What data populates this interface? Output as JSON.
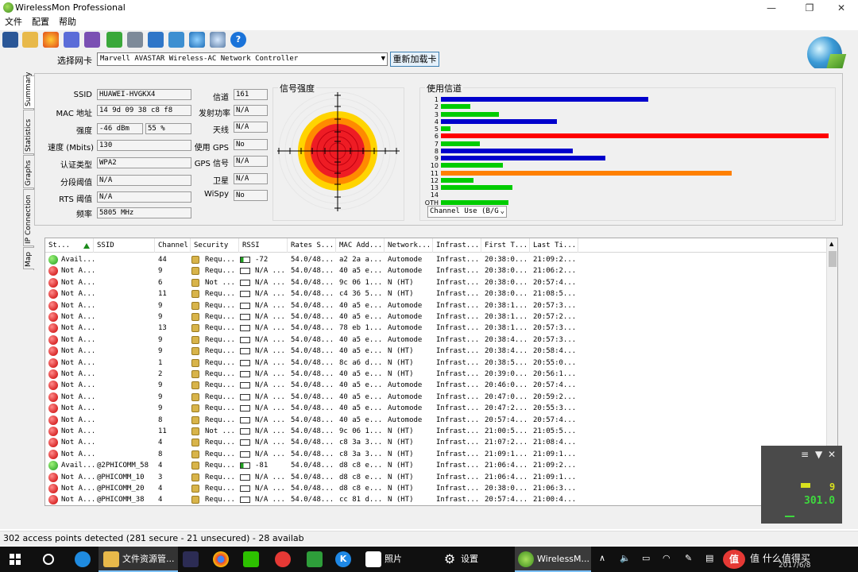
{
  "window": {
    "title": "WirelessMon Professional",
    "min": "—",
    "max": "❐",
    "close": "✕"
  },
  "menu": [
    "文件",
    "配置",
    "帮助"
  ],
  "nic": {
    "label": "选择网卡",
    "value": "Marvell AVASTAR Wireless-AC Network Controller",
    "reload": "重新加载卡"
  },
  "tabs": [
    "Summary",
    "Statistics",
    "Graphs",
    "IP Connection",
    "Map"
  ],
  "summary": {
    "ssid": {
      "label": "SSID",
      "value": "HUAWEI-HVGKX4"
    },
    "mac": {
      "label": "MAC 地址",
      "value": "14 9d 09 38 c8 f8"
    },
    "strength": {
      "label": "强度",
      "dbm": "-46 dBm",
      "pct": "55 %"
    },
    "speed": {
      "label": "速度 (Mbits)",
      "value": "130"
    },
    "auth": {
      "label": "认证类型",
      "value": "WPA2"
    },
    "frag": {
      "label": "分段阈值",
      "value": "N/A"
    },
    "rts": {
      "label": "RTS 阈值",
      "value": "N/A"
    },
    "freq": {
      "label": "频率",
      "value": "5805 MHz"
    },
    "channel": {
      "label": "信道",
      "value": "161"
    },
    "txpower": {
      "label": "发射功率",
      "value": "N/A"
    },
    "antenna": {
      "label": "天线",
      "value": "N/A"
    },
    "gps_use": {
      "label": "使用 GPS",
      "value": "No"
    },
    "gps_sig": {
      "label": "GPS 信号",
      "value": "N/A"
    },
    "sat": {
      "label": "卫星",
      "value": "N/A"
    },
    "wispy": {
      "label": "WiSpy",
      "value": "No"
    }
  },
  "signal_title": "信号强度",
  "channel_title": "使用信道",
  "channel_select": "Channel Use (B/G",
  "channel_max": 20,
  "channels": [
    {
      "label": "1",
      "value": 10.7,
      "color": "#0000cc"
    },
    {
      "label": "2",
      "value": 1.5,
      "color": "#00cc00"
    },
    {
      "label": "3",
      "value": 3.0,
      "color": "#00cc00"
    },
    {
      "label": "4",
      "value": 6.0,
      "color": "#0000cc"
    },
    {
      "label": "5",
      "value": 0.5,
      "color": "#00cc00"
    },
    {
      "label": "6",
      "value": 20.0,
      "color": "#ff0000"
    },
    {
      "label": "7",
      "value": 2.0,
      "color": "#00cc00"
    },
    {
      "label": "8",
      "value": 6.8,
      "color": "#0000cc"
    },
    {
      "label": "9",
      "value": 8.5,
      "color": "#0000cc"
    },
    {
      "label": "10",
      "value": 3.2,
      "color": "#00cc00"
    },
    {
      "label": "11",
      "value": 15.0,
      "color": "#ff8000"
    },
    {
      "label": "12",
      "value": 1.7,
      "color": "#00cc00"
    },
    {
      "label": "13",
      "value": 3.7,
      "color": "#00cc00"
    },
    {
      "label": "14",
      "value": 0,
      "color": "#00cc00"
    },
    {
      "label": "OTH",
      "value": 3.5,
      "color": "#00cc00"
    }
  ],
  "columns": [
    "St...",
    "SSID",
    "Channel",
    "Security",
    "RSSI",
    "Rates S...",
    "MAC Add...",
    "Network...",
    "Infrast...",
    "First T...",
    "Last Ti..."
  ],
  "rows": [
    {
      "status": "Avail...",
      "ok": true,
      "ssid": "",
      "ch": "44",
      "sec": "Requ...",
      "rssi": "-72",
      "rates": "54.0/48...",
      "mac": "a2 2a a...",
      "net": "Automode",
      "infra": "Infrast...",
      "first": "20:38:0...",
      "last": "21:09:2..."
    },
    {
      "status": "Not A...",
      "ok": false,
      "ssid": "",
      "ch": "9",
      "sec": "Requ...",
      "rssi": "N/A ...",
      "rates": "54.0/48...",
      "mac": "40 a5 e...",
      "net": "Automode",
      "infra": "Infrast...",
      "first": "20:38:0...",
      "last": "21:06:2..."
    },
    {
      "status": "Not A...",
      "ok": false,
      "ssid": "",
      "ch": "6",
      "sec": "Not ...",
      "rssi": "N/A ...",
      "rates": "54.0/48...",
      "mac": "9c 06 1...",
      "net": "N (HT)",
      "infra": "Infrast...",
      "first": "20:38:0...",
      "last": "20:57:4..."
    },
    {
      "status": "Not A...",
      "ok": false,
      "ssid": "",
      "ch": "11",
      "sec": "Requ...",
      "rssi": "N/A ...",
      "rates": "54.0/48...",
      "mac": "c4 36 5...",
      "net": "N (HT)",
      "infra": "Infrast...",
      "first": "20:38:0...",
      "last": "21:08:5..."
    },
    {
      "status": "Not A...",
      "ok": false,
      "ssid": "",
      "ch": "9",
      "sec": "Requ...",
      "rssi": "N/A ...",
      "rates": "54.0/48...",
      "mac": "40 a5 e...",
      "net": "Automode",
      "infra": "Infrast...",
      "first": "20:38:1...",
      "last": "20:57:3..."
    },
    {
      "status": "Not A...",
      "ok": false,
      "ssid": "",
      "ch": "9",
      "sec": "Requ...",
      "rssi": "N/A ...",
      "rates": "54.0/48...",
      "mac": "40 a5 e...",
      "net": "Automode",
      "infra": "Infrast...",
      "first": "20:38:1...",
      "last": "20:57:2..."
    },
    {
      "status": "Not A...",
      "ok": false,
      "ssid": "",
      "ch": "13",
      "sec": "Requ...",
      "rssi": "N/A ...",
      "rates": "54.0/48...",
      "mac": "78 eb 1...",
      "net": "Automode",
      "infra": "Infrast...",
      "first": "20:38:1...",
      "last": "20:57:3..."
    },
    {
      "status": "Not A...",
      "ok": false,
      "ssid": "",
      "ch": "9",
      "sec": "Requ...",
      "rssi": "N/A ...",
      "rates": "54.0/48...",
      "mac": "40 a5 e...",
      "net": "Automode",
      "infra": "Infrast...",
      "first": "20:38:4...",
      "last": "20:57:3..."
    },
    {
      "status": "Not A...",
      "ok": false,
      "ssid": "",
      "ch": "9",
      "sec": "Requ...",
      "rssi": "N/A ...",
      "rates": "54.0/48...",
      "mac": "40 a5 e...",
      "net": "N (HT)",
      "infra": "Infrast...",
      "first": "20:38:4...",
      "last": "20:58:4..."
    },
    {
      "status": "Not A...",
      "ok": false,
      "ssid": "",
      "ch": "1",
      "sec": "Requ...",
      "rssi": "N/A ...",
      "rates": "54.0/48...",
      "mac": "8c a6 d...",
      "net": "N (HT)",
      "infra": "Infrast...",
      "first": "20:38:5...",
      "last": "20:55:0..."
    },
    {
      "status": "Not A...",
      "ok": false,
      "ssid": "",
      "ch": "2",
      "sec": "Requ...",
      "rssi": "N/A ...",
      "rates": "54.0/48...",
      "mac": "40 a5 e...",
      "net": "N (HT)",
      "infra": "Infrast...",
      "first": "20:39:0...",
      "last": "20:56:1..."
    },
    {
      "status": "Not A...",
      "ok": false,
      "ssid": "",
      "ch": "9",
      "sec": "Requ...",
      "rssi": "N/A ...",
      "rates": "54.0/48...",
      "mac": "40 a5 e...",
      "net": "Automode",
      "infra": "Infrast...",
      "first": "20:46:0...",
      "last": "20:57:4..."
    },
    {
      "status": "Not A...",
      "ok": false,
      "ssid": "",
      "ch": "9",
      "sec": "Requ...",
      "rssi": "N/A ...",
      "rates": "54.0/48...",
      "mac": "40 a5 e...",
      "net": "Automode",
      "infra": "Infrast...",
      "first": "20:47:0...",
      "last": "20:59:2..."
    },
    {
      "status": "Not A...",
      "ok": false,
      "ssid": "",
      "ch": "9",
      "sec": "Requ...",
      "rssi": "N/A ...",
      "rates": "54.0/48...",
      "mac": "40 a5 e...",
      "net": "Automode",
      "infra": "Infrast...",
      "first": "20:47:2...",
      "last": "20:55:3..."
    },
    {
      "status": "Not A...",
      "ok": false,
      "ssid": "",
      "ch": "8",
      "sec": "Requ...",
      "rssi": "N/A ...",
      "rates": "54.0/48...",
      "mac": "40 a5 e...",
      "net": "Automode",
      "infra": "Infrast...",
      "first": "20:57:4...",
      "last": "20:57:4..."
    },
    {
      "status": "Not A...",
      "ok": false,
      "ssid": "",
      "ch": "11",
      "sec": "Not ...",
      "rssi": "N/A ...",
      "rates": "54.0/48...",
      "mac": "9c 06 1...",
      "net": "N (HT)",
      "infra": "Infrast...",
      "first": "21:00:5...",
      "last": "21:05:5..."
    },
    {
      "status": "Not A...",
      "ok": false,
      "ssid": "",
      "ch": "4",
      "sec": "Requ...",
      "rssi": "N/A ...",
      "rates": "54.0/48...",
      "mac": "c8 3a 3...",
      "net": "N (HT)",
      "infra": "Infrast...",
      "first": "21:07:2...",
      "last": "21:08:4..."
    },
    {
      "status": "Not A...",
      "ok": false,
      "ssid": "",
      "ch": "8",
      "sec": "Requ...",
      "rssi": "N/A ...",
      "rates": "54.0/48...",
      "mac": "c8 3a 3...",
      "net": "N (HT)",
      "infra": "Infrast...",
      "first": "21:09:1...",
      "last": "21:09:1..."
    },
    {
      "status": "Avail...",
      "ok": true,
      "ssid": "@2PHICOMM_58",
      "ch": "4",
      "sec": "Requ...",
      "rssi": "-81",
      "rates": "54.0/48...",
      "mac": "d8 c8 e...",
      "net": "N (HT)",
      "infra": "Infrast...",
      "first": "21:06:4...",
      "last": "21:09:2..."
    },
    {
      "status": "Not A...",
      "ok": false,
      "ssid": "@PHICOMM_10",
      "ch": "3",
      "sec": "Requ...",
      "rssi": "N/A ...",
      "rates": "54.0/48...",
      "mac": "d8 c8 e...",
      "net": "N (HT)",
      "infra": "Infrast...",
      "first": "21:06:4...",
      "last": "21:09:1..."
    },
    {
      "status": "Not A...",
      "ok": false,
      "ssid": "@PHICOMM_20",
      "ch": "4",
      "sec": "Requ...",
      "rssi": "N/A ...",
      "rates": "54.0/48...",
      "mac": "d8 c8 e...",
      "net": "N (HT)",
      "infra": "Infrast...",
      "first": "20:38:0...",
      "last": "21:06:3..."
    },
    {
      "status": "Not A...",
      "ok": false,
      "ssid": "@PHICOMM_38",
      "ch": "4",
      "sec": "Requ...",
      "rssi": "N/A ...",
      "rates": "54.0/48...",
      "mac": "cc 81 d...",
      "net": "N (HT)",
      "infra": "Infrast...",
      "first": "20:57:4...",
      "last": "21:00:4..."
    }
  ],
  "status_text": "302 access points detected (281 secure - 21 unsecured) - 28 availab",
  "overlay": {
    "value1": "9",
    "value2": "301.0"
  },
  "taskbar": {
    "explorer": "文件资源管...",
    "photos": "照片",
    "settings": "设置",
    "wirelessmon": "WirelessM...",
    "date": "2017/6/8",
    "brand": "值 什么值得买"
  }
}
